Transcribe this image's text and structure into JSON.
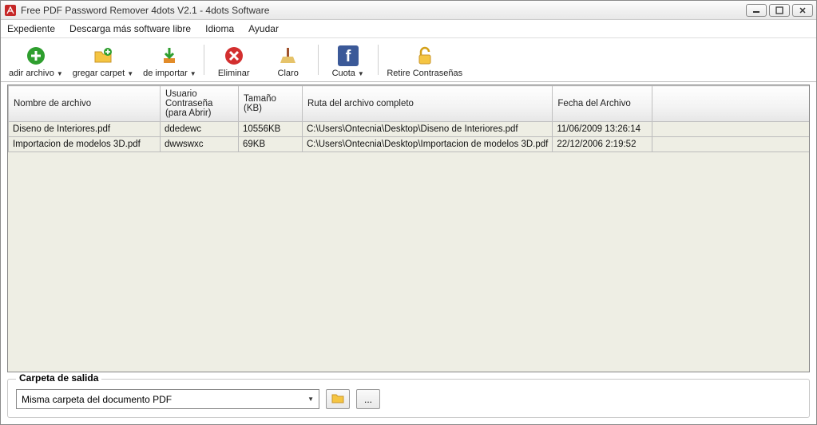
{
  "window": {
    "title": "Free PDF Password Remover 4dots V2.1 - 4dots Software"
  },
  "menu": {
    "file": "Expediente",
    "download": "Descarga más software libre",
    "language": "Idioma",
    "help": "Ayudar"
  },
  "toolbar": {
    "add_file": "adir archivo",
    "add_folder": "gregar carpet",
    "import": "de importar",
    "remove": "Eliminar",
    "clear": "Claro",
    "quota": "Cuota",
    "remove_passwords": "Retire Contraseñas"
  },
  "table": {
    "headers": {
      "name": "Nombre de archivo",
      "password": "Usuario Contraseña (para Abrir)",
      "size": "Tamaño (KB)",
      "path": "Ruta del archivo completo",
      "date": "Fecha del Archivo"
    },
    "rows": [
      {
        "name": "Diseno de Interiores.pdf",
        "password": "ddedewc",
        "size": "10556KB",
        "path": "C:\\Users\\Ontecnia\\Desktop\\Diseno de Interiores.pdf",
        "date": "11/06/2009 13:26:14"
      },
      {
        "name": "Importacion de modelos 3D.pdf",
        "password": "dwwswxc",
        "size": "69KB",
        "path": "C:\\Users\\Ontecnia\\Desktop\\Importacion de modelos 3D.pdf",
        "date": "22/12/2006 2:19:52"
      }
    ]
  },
  "output": {
    "legend": "Carpeta de salida",
    "selected": "Misma carpeta del documento PDF",
    "browse_ellipsis": "..."
  }
}
